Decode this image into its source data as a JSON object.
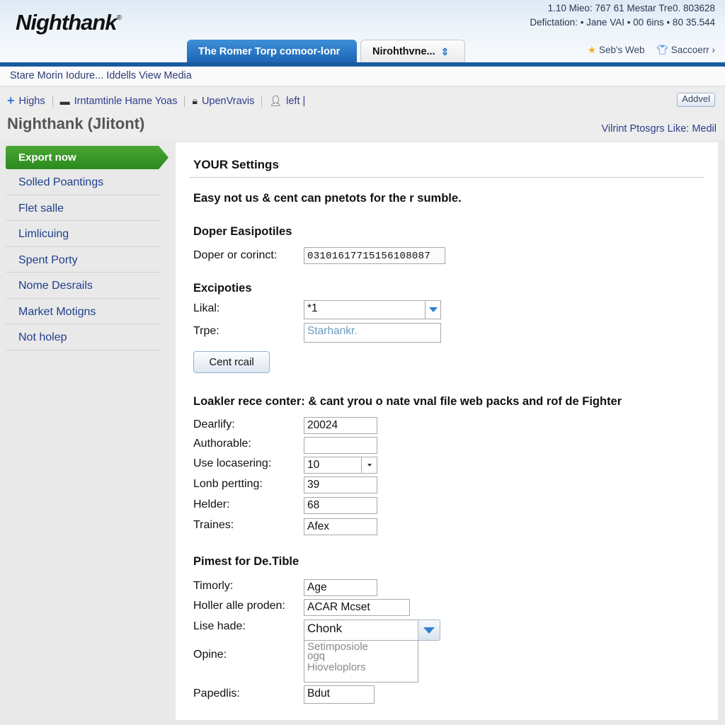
{
  "header": {
    "logo": "Nighthank",
    "logo_mark": "®",
    "meta_line1": "1.10 Mieo: 767 61  Mestar  Tre0. 803628",
    "meta_line2": "Defictation:  •  Jane VAI  •  00 6ins  •  80 35.544",
    "tabs": [
      {
        "label": "The Romer Torp comoor-lonr",
        "active": true
      },
      {
        "label": "Nirohthvne...",
        "active": false,
        "icon": "sort-arrows-icon"
      }
    ],
    "links": [
      {
        "label": "Seb's Web",
        "icon": "star-icon"
      },
      {
        "label": "Saccoerr",
        "icon": "shirt-icon",
        "suffix": "›"
      }
    ]
  },
  "menubar": {
    "text": "Stare Morin Iodure... Iddells View Media"
  },
  "toolbar": {
    "items": [
      {
        "label": "Highs",
        "icon": "plus-icon"
      },
      {
        "label": "Irntamtinle Hame Yoas",
        "icon": "monitor-icon"
      },
      {
        "label": "UpenVravis",
        "icon": "lock-icon"
      },
      {
        "label": "left |",
        "icon": "user-icon"
      }
    ],
    "add_button": "Addvel",
    "page_title": "Nighthank (Jlitont)",
    "right_link": "Vilrint Ptosgrs Like: Medil"
  },
  "sidebar": {
    "active": "Export now",
    "items": [
      "Solled Poantings",
      "Flet salle",
      "Limlicuing",
      "Spent Porty",
      "Nome Desrails",
      "Market Motigns",
      "Not holep"
    ]
  },
  "panel": {
    "title": "YOUR Settings",
    "intro": "Easy not us & cent can pnetots for the r sumble.",
    "section1": {
      "heading": "Doper Easipotiles",
      "label": "Doper or corinct:",
      "value": "03101617715156108087"
    },
    "section2": {
      "heading": "Excipoties",
      "fields": [
        {
          "label": "Likal:",
          "value": "*1"
        },
        {
          "label": "Trpe:",
          "placeholder": "Starhankr."
        }
      ],
      "button": "Cent rcail"
    },
    "section3": {
      "heading": "Loakler rece conter: & cant yrou o nate vnal file web packs and rof de Fighter",
      "fields": [
        {
          "label": "Dearlify:",
          "value": "20024"
        },
        {
          "label": "Authorable:",
          "value": ""
        },
        {
          "label": "Use locasering:",
          "value": "10"
        },
        {
          "label": "Lonb pertting:",
          "value": "39"
        },
        {
          "label": "Helder:",
          "value": "68"
        },
        {
          "label": "Traines:",
          "value": "Afex"
        }
      ]
    },
    "section4": {
      "heading": "Pimest for De.Tible",
      "fields": [
        {
          "label": "Timorly:",
          "value": "Age"
        },
        {
          "label": "Holler alle proden:",
          "value": "ACAR Mcset"
        },
        {
          "label": "Lise hade:",
          "value": "Chonk"
        },
        {
          "label": "Opine:",
          "options": [
            "Setimposiole",
            "ogq",
            "Hioveloplors"
          ]
        },
        {
          "label": "Papedlis:",
          "value": "Bdut"
        }
      ]
    }
  }
}
